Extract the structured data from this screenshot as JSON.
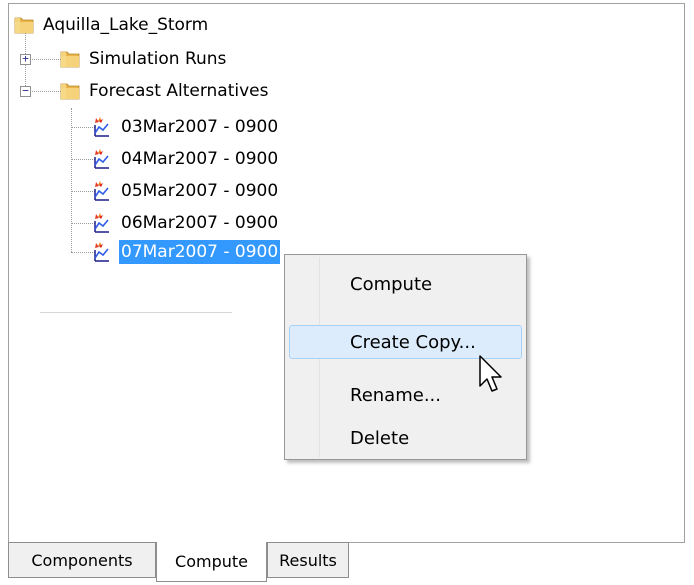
{
  "tree": {
    "root": {
      "label": "Aquilla_Lake_Storm",
      "icon": "folder-icon"
    },
    "simulation_runs": {
      "label": "Simulation Runs",
      "expander": "+",
      "icon": "folder-icon"
    },
    "forecast_alternatives": {
      "label": "Forecast Alternatives",
      "expander": "−",
      "icon": "folder-icon"
    },
    "alternatives": [
      {
        "label": "03Mar2007 - 0900",
        "icon": "forecast-alternative-icon"
      },
      {
        "label": "04Mar2007 - 0900",
        "icon": "forecast-alternative-icon"
      },
      {
        "label": "05Mar2007 - 0900",
        "icon": "forecast-alternative-icon"
      },
      {
        "label": "06Mar2007 - 0900",
        "icon": "forecast-alternative-icon"
      },
      {
        "label": "07Mar2007 - 0900",
        "icon": "forecast-alternative-icon",
        "selected": true
      }
    ]
  },
  "context_menu": {
    "items": [
      {
        "label": "Compute"
      },
      {
        "label": "Create Copy...",
        "hover": true
      },
      {
        "label": "Rename..."
      },
      {
        "label": "Delete"
      }
    ]
  },
  "tabs": [
    {
      "label": "Components"
    },
    {
      "label": "Compute",
      "active": true
    },
    {
      "label": "Results"
    }
  ],
  "colors": {
    "selection": "#3399ff",
    "menu_hover": "#dcecfc",
    "folder": "#f3c55a"
  }
}
